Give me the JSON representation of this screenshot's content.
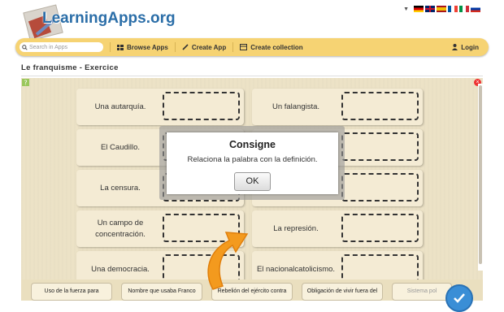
{
  "brand": {
    "name": "LearningApps.org"
  },
  "header": {
    "flags": [
      {
        "name": "de-flag",
        "colors": [
          "#000000",
          "#dd0000",
          "#ffce00"
        ]
      },
      {
        "name": "uk-flag",
        "colors": [
          "#012169",
          "#c8102e",
          "#ffffff"
        ]
      },
      {
        "name": "es-flag",
        "colors": [
          "#aa151b",
          "#f1bf00",
          "#aa151b"
        ]
      },
      {
        "name": "fr-flag",
        "colors": [
          "#0055a4",
          "#ffffff",
          "#ef4135"
        ]
      },
      {
        "name": "it-flag",
        "colors": [
          "#009246",
          "#ffffff",
          "#ce2b37"
        ]
      },
      {
        "name": "ru-flag",
        "colors": [
          "#ffffff",
          "#0039a6",
          "#d52b1e"
        ]
      }
    ]
  },
  "nav": {
    "search_placeholder": "Search in Apps",
    "browse": "Browse Apps",
    "create_app": "Create App",
    "create_collection": "Create collection",
    "login": "Login"
  },
  "page": {
    "title": "Le franquisme - Exercice"
  },
  "exercise": {
    "pairs": [
      {
        "label": "Una autarquía."
      },
      {
        "label": "Un falangista."
      },
      {
        "label": "El Caudillo."
      },
      {
        "label": ""
      },
      {
        "label": "La censura."
      },
      {
        "label": ""
      },
      {
        "label": "Un campo de concentración."
      },
      {
        "label": "La represión."
      },
      {
        "label": "Una democracia."
      },
      {
        "label": "El nacionalcatolicismo."
      }
    ],
    "cards": [
      "Uso de la fuerza para",
      "Nombre que usaba Franco",
      "Rebelión del ejército contra",
      "Obligación de vivir fuera del",
      "Sistema pol"
    ]
  },
  "dialog": {
    "title": "Consigne",
    "text": "Relaciona la palabra con la definición.",
    "ok": "OK"
  },
  "colors": {
    "brand_blue": "#2b6ea8",
    "nav_yellow": "#f6d373",
    "app_background": "#ece2c6",
    "arrow_orange": "#f39a1e",
    "check_blue": "#3a8ed6"
  }
}
